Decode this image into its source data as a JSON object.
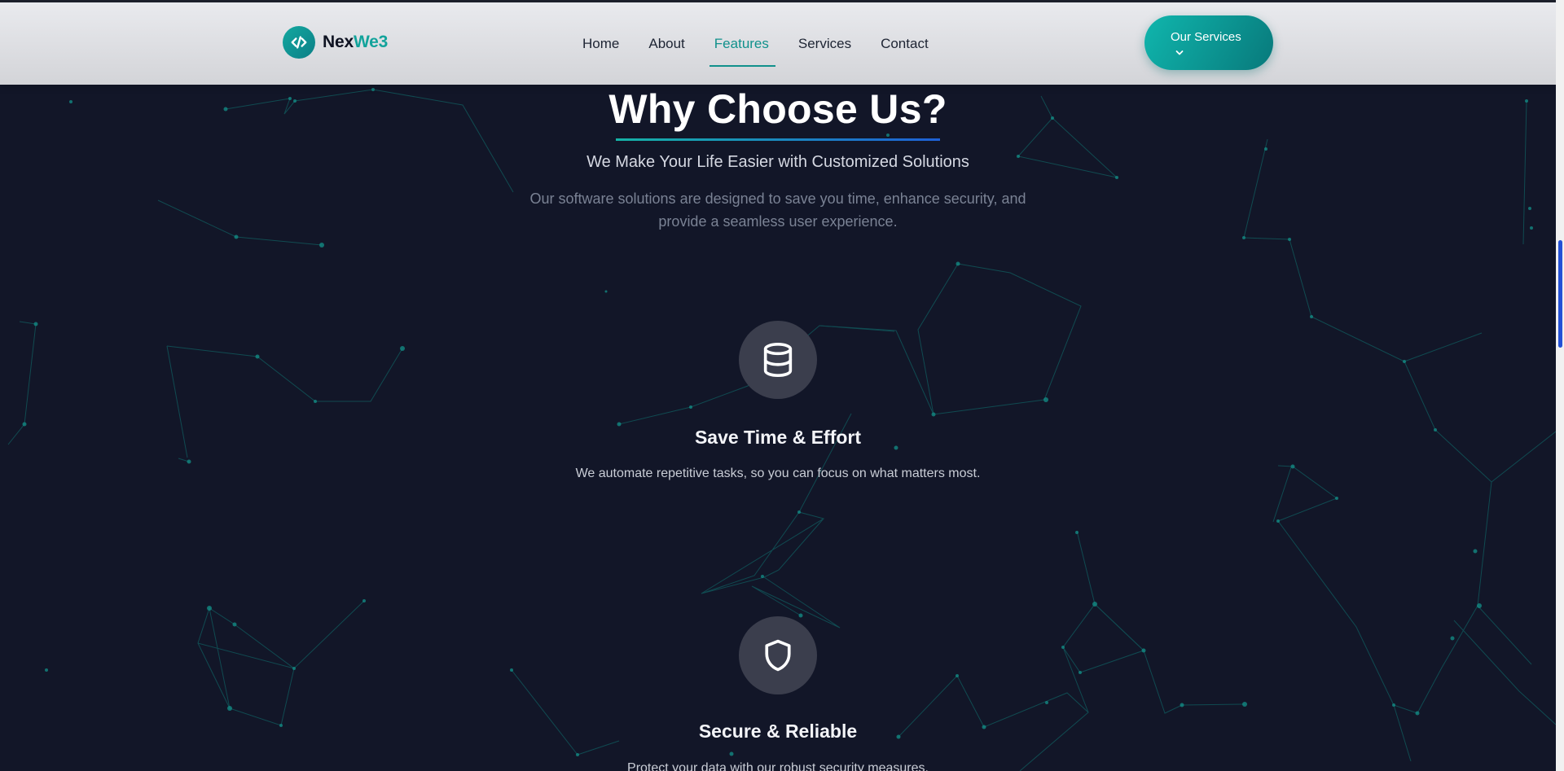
{
  "header": {
    "brand_main": "Nex",
    "brand_accent": "We3",
    "nav": [
      {
        "label": "Home",
        "active": false
      },
      {
        "label": "About",
        "active": false
      },
      {
        "label": "Features",
        "active": true
      },
      {
        "label": "Services",
        "active": false
      },
      {
        "label": "Contact",
        "active": false
      }
    ],
    "cta_label": "Our Services"
  },
  "section": {
    "title": "Why Choose Us?",
    "subtitle": "We Make Your Life Easier with Customized Solutions",
    "description": "Our software solutions are designed to save you time, enhance security, and provide a seamless user experience."
  },
  "features": [
    {
      "icon": "database-icon",
      "title": "Save Time & Effort",
      "description": "We automate repetitive tasks, so you can focus on what matters most."
    },
    {
      "icon": "shield-icon",
      "title": "Secure & Reliable",
      "description": "Protect your data with our robust security measures."
    }
  ],
  "colors": {
    "background": "#121628",
    "accent": "#12a39b",
    "navbar": "#d9dade",
    "icon_circle": "#3b3e4d"
  }
}
